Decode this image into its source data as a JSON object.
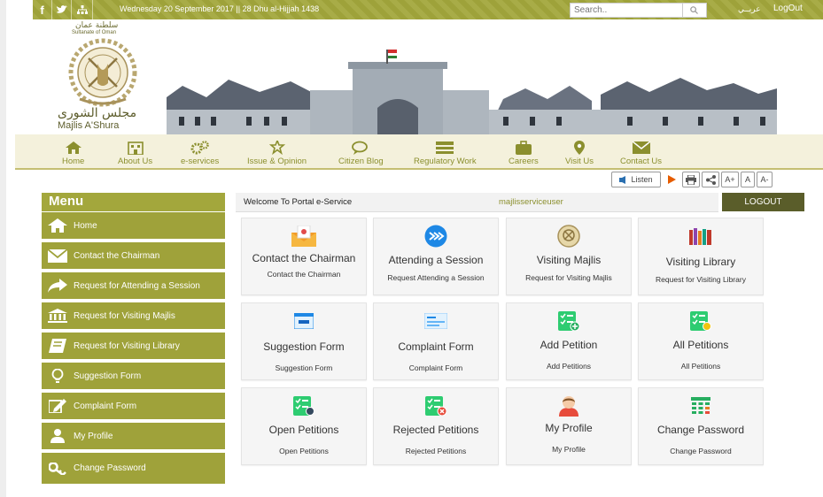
{
  "topbar": {
    "date": "Wednesday 20 September 2017 || 28 Dhu al-Hijjah 1438",
    "search_placeholder": "Search..",
    "arabic_link": "عربــي",
    "logout": "LogOut"
  },
  "logo": {
    "arabic_top": "سلطنة عمان",
    "english_top": "Sultanate of Oman",
    "arabic_name": "مجلس الشورى",
    "english_name": "Majlis A'Shura"
  },
  "nav": [
    {
      "label": "Home",
      "icon": "home-icon"
    },
    {
      "label": "About Us",
      "icon": "building-icon"
    },
    {
      "label": "e-services",
      "icon": "gears-icon"
    },
    {
      "label": "Issue & Opinion",
      "icon": "star-hand-icon"
    },
    {
      "label": "Citizen Blog",
      "icon": "chat-icon"
    },
    {
      "label": "Regulatory Work",
      "icon": "list-icon"
    },
    {
      "label": "Careers",
      "icon": "briefcase-icon"
    },
    {
      "label": "Visit Us",
      "icon": "map-pin-icon"
    },
    {
      "label": "Contact Us",
      "icon": "envelope-icon"
    }
  ],
  "tools": {
    "listen": "Listen",
    "font_up": "A+",
    "font_normal": "A",
    "font_down": "A-"
  },
  "sidebar": {
    "title": "Menu",
    "items": [
      {
        "label": "Home",
        "icon": "home-icon"
      },
      {
        "label": "Contact the Chairman",
        "icon": "envelope-icon"
      },
      {
        "label": "Request for Attending a Session",
        "icon": "share-arrow-icon"
      },
      {
        "label": "Request for Visiting Majlis",
        "icon": "bank-icon"
      },
      {
        "label": "Request for Visiting Library",
        "icon": "book-icon"
      },
      {
        "label": "Suggestion Form",
        "icon": "lightbulb-icon"
      },
      {
        "label": "Complaint Form",
        "icon": "edit-icon"
      },
      {
        "label": "My Profile",
        "icon": "user-icon"
      },
      {
        "label": "Change Password",
        "icon": "key-icon"
      }
    ]
  },
  "welcome": {
    "text": "Welcome To Portal e-Service",
    "username": "majlisserviceuser",
    "logout": "LOGOUT"
  },
  "cards": [
    {
      "title": "Contact the Chairman",
      "sub": "Contact the Chairman",
      "icon": "mail-icon"
    },
    {
      "title": "Attending a Session",
      "sub": "Request Attending a Session",
      "icon": "forward-icon"
    },
    {
      "title": "Visiting Majlis",
      "sub": "Request for Visiting Majlis",
      "icon": "emblem-icon"
    },
    {
      "title": "Visiting Library",
      "sub": "Request for Visiting Library",
      "icon": "books-icon"
    },
    {
      "title": "Suggestion Form",
      "sub": "Suggestion Form",
      "icon": "form-icon"
    },
    {
      "title": "Complaint Form",
      "sub": "Complaint Form",
      "icon": "complaint-icon"
    },
    {
      "title": "Add Petition",
      "sub": "Add Petitions",
      "icon": "checklist-add-icon"
    },
    {
      "title": "All Petitions",
      "sub": "All Petitions",
      "icon": "checklist-icon"
    },
    {
      "title": "Open Petitions",
      "sub": "Open Petitions",
      "icon": "checklist-view-icon"
    },
    {
      "title": "Rejected Petitions",
      "sub": "Rejected Petitions",
      "icon": "checklist-reject-icon"
    },
    {
      "title": "My Profile",
      "sub": "My Profile",
      "icon": "profile-icon"
    },
    {
      "title": "Change Password",
      "sub": "Change Password",
      "icon": "keypad-icon"
    }
  ],
  "colors": {
    "olive": "#a3a73c",
    "olive_dark": "#5a5d2a",
    "text_olive": "#8b8f2e"
  }
}
